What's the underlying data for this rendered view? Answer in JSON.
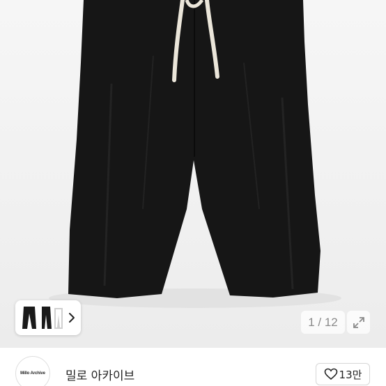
{
  "gallery": {
    "counter": "1 / 12",
    "expand_icon": "expand-arrows-icon",
    "thumbnail_next_icon": "chevron-right-icon"
  },
  "seller": {
    "avatar_text": "Millo Archive",
    "name": "밀로 아카이브"
  },
  "like": {
    "icon": "heart-outline-icon",
    "count": "13만"
  },
  "colors": {
    "background": "#f2f2f2",
    "product": "#161616",
    "drawstring": "#ebe6da"
  }
}
